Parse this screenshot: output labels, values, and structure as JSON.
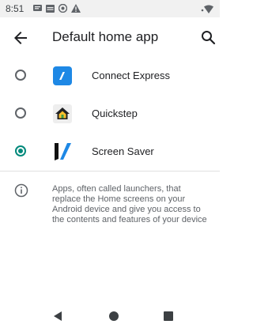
{
  "status_bar": {
    "time": "8:51",
    "icons": [
      "message-icon",
      "calendar-icon",
      "settings-status-icon",
      "warning-icon"
    ],
    "right_icons": [
      "signal-dot-icon",
      "wifi-icon"
    ]
  },
  "app_bar": {
    "title": "Default home app",
    "back_icon": "back-arrow-icon",
    "search_icon": "search-icon"
  },
  "apps": [
    {
      "label": "Connect Express",
      "icon": "connect-express-icon",
      "selected": false
    },
    {
      "label": "Quickstep",
      "icon": "quickstep-home-icon",
      "selected": false
    },
    {
      "label": "Screen Saver",
      "icon": "screen-saver-icon",
      "selected": true
    }
  ],
  "info": {
    "icon": "info-icon",
    "text": "Apps, often called launchers, that replace the Home screens on your Android device and give you access to the contents and features of your device"
  },
  "nav": {
    "icons": [
      "nav-back-icon",
      "nav-home-icon",
      "nav-recents-icon"
    ]
  },
  "colors": {
    "accent": "#00897b",
    "connect_express_bg": "#1e88e5",
    "screen_saver_blue": "#1e88e5",
    "screen_saver_dark": "#111111"
  }
}
